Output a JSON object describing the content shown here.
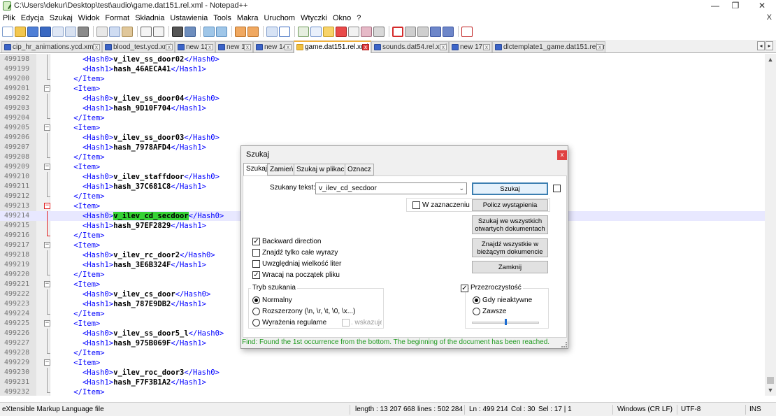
{
  "window": {
    "title": "C:\\Users\\dekur\\Desktop\\test\\audio\\game.dat151.rel.xml - Notepad++",
    "minimize": "—",
    "maximize": "❐",
    "close": "✕"
  },
  "menu": {
    "items": [
      "Plik",
      "Edycja",
      "Szukaj",
      "Widok",
      "Format",
      "Składnia",
      "Ustawienia",
      "Tools",
      "Makra",
      "Uruchom",
      "Wtyczki",
      "Okno",
      "?"
    ],
    "close": "X"
  },
  "tabs": [
    {
      "label": "cip_hr_animations.ycd.xml",
      "close": "x"
    },
    {
      "label": "blood_test.ycd.xml",
      "close": "x"
    },
    {
      "label": "new 12",
      "close": "x"
    },
    {
      "label": "new 13",
      "close": "x"
    },
    {
      "label": "new 14",
      "close": "x"
    },
    {
      "label": "game.dat151.rel.xml",
      "close": "x"
    },
    {
      "label": "sounds.dat54.rel.xml",
      "close": "x"
    },
    {
      "label": "new 17",
      "close": "x"
    },
    {
      "label": "dlctemplate1_game.dat151.rel.xml",
      "close": "x"
    }
  ],
  "tab_scroll": {
    "left": "◂",
    "right": "▸"
  },
  "editor": {
    "lines": [
      {
        "num": "499198",
        "pre": "      ",
        "open": "<Hash0>",
        "text": "v_ilev_ss_door02",
        "close": "</Hash0>"
      },
      {
        "num": "499199",
        "pre": "      ",
        "open": "<Hash1>",
        "text": "hash_46AECA41",
        "close": "</Hash1>"
      },
      {
        "num": "499200",
        "pre": "    ",
        "open": "</Item>",
        "text": "",
        "close": ""
      },
      {
        "num": "499201",
        "pre": "    ",
        "open": "<Item>",
        "text": "",
        "close": ""
      },
      {
        "num": "499202",
        "pre": "      ",
        "open": "<Hash0>",
        "text": "v_ilev_ss_door04",
        "close": "</Hash0>"
      },
      {
        "num": "499203",
        "pre": "      ",
        "open": "<Hash1>",
        "text": "hash_9D10F704",
        "close": "</Hash1>"
      },
      {
        "num": "499204",
        "pre": "    ",
        "open": "</Item>",
        "text": "",
        "close": ""
      },
      {
        "num": "499205",
        "pre": "    ",
        "open": "<Item>",
        "text": "",
        "close": ""
      },
      {
        "num": "499206",
        "pre": "      ",
        "open": "<Hash0>",
        "text": "v_ilev_ss_door03",
        "close": "</Hash0>"
      },
      {
        "num": "499207",
        "pre": "      ",
        "open": "<Hash1>",
        "text": "hash_7978AFD4",
        "close": "</Hash1>"
      },
      {
        "num": "499208",
        "pre": "    ",
        "open": "</Item>",
        "text": "",
        "close": ""
      },
      {
        "num": "499209",
        "pre": "    ",
        "open": "<Item>",
        "text": "",
        "close": ""
      },
      {
        "num": "499210",
        "pre": "      ",
        "open": "<Hash0>",
        "text": "v_ilev_staffdoor",
        "close": "</Hash0>"
      },
      {
        "num": "499211",
        "pre": "      ",
        "open": "<Hash1>",
        "text": "hash_37C681C8",
        "close": "</Hash1>"
      },
      {
        "num": "499212",
        "pre": "    ",
        "open": "</Item>",
        "text": "",
        "close": ""
      },
      {
        "num": "499213",
        "pre": "    ",
        "open": "<Item>",
        "text": "",
        "close": ""
      },
      {
        "num": "499214",
        "pre": "      ",
        "open": "<Hash0>",
        "text": "v_ilev_cd_secdoor",
        "close": "</Hash0>"
      },
      {
        "num": "499215",
        "pre": "      ",
        "open": "<Hash1>",
        "text": "hash_97EF2829",
        "close": "</Hash1>"
      },
      {
        "num": "499216",
        "pre": "    ",
        "open": "</Item>",
        "text": "",
        "close": ""
      },
      {
        "num": "499217",
        "pre": "    ",
        "open": "<Item>",
        "text": "",
        "close": ""
      },
      {
        "num": "499218",
        "pre": "      ",
        "open": "<Hash0>",
        "text": "v_ilev_rc_door2",
        "close": "</Hash0>"
      },
      {
        "num": "499219",
        "pre": "      ",
        "open": "<Hash1>",
        "text": "hash_3E6B324F",
        "close": "</Hash1>"
      },
      {
        "num": "499220",
        "pre": "    ",
        "open": "</Item>",
        "text": "",
        "close": ""
      },
      {
        "num": "499221",
        "pre": "    ",
        "open": "<Item>",
        "text": "",
        "close": ""
      },
      {
        "num": "499222",
        "pre": "      ",
        "open": "<Hash0>",
        "text": "v_ilev_cs_door",
        "close": "</Hash0>"
      },
      {
        "num": "499223",
        "pre": "      ",
        "open": "<Hash1>",
        "text": "hash_787E9DB2",
        "close": "</Hash1>"
      },
      {
        "num": "499224",
        "pre": "    ",
        "open": "</Item>",
        "text": "",
        "close": ""
      },
      {
        "num": "499225",
        "pre": "    ",
        "open": "<Item>",
        "text": "",
        "close": ""
      },
      {
        "num": "499226",
        "pre": "      ",
        "open": "<Hash0>",
        "text": "v_ilev_ss_door5_l",
        "close": "</Hash0>"
      },
      {
        "num": "499227",
        "pre": "      ",
        "open": "<Hash1>",
        "text": "hash_975B069F",
        "close": "</Hash1>"
      },
      {
        "num": "499228",
        "pre": "    ",
        "open": "</Item>",
        "text": "",
        "close": ""
      },
      {
        "num": "499229",
        "pre": "    ",
        "open": "<Item>",
        "text": "",
        "close": ""
      },
      {
        "num": "499230",
        "pre": "      ",
        "open": "<Hash0>",
        "text": "v_ilev_roc_door3",
        "close": "</Hash0>"
      },
      {
        "num": "499231",
        "pre": "      ",
        "open": "<Hash1>",
        "text": "hash_F7F3B1A2",
        "close": "</Hash1>"
      },
      {
        "num": "499232",
        "pre": "    ",
        "open": "</Item>",
        "text": "",
        "close": ""
      },
      {
        "num": "499233",
        "pre": "    ",
        "open": "<Item>",
        "text": "",
        "close": ""
      }
    ],
    "highlight_line": "499214",
    "highlight_text": "v_ilev_cd_secdoor"
  },
  "scrollbar": {
    "up": "▲",
    "down": "▼"
  },
  "find_dialog": {
    "title": "Szukaj",
    "close": "x",
    "tabs": [
      "Szukaj",
      "Zamień",
      "Szukaj w plikach",
      "Oznacz"
    ],
    "search_label": "Szukany tekst:",
    "search_value": "v_ilev_cd_secdoor",
    "chevron": "⌄",
    "in_selection_label": "W zaznaczeniu",
    "buttons": {
      "find": "Szukaj",
      "count": "Policz wystąpienia",
      "find_all_open_line1": "Szukaj we wszystkich",
      "find_all_open_line2": "otwartych dokumentach",
      "find_all_current_line1": "Znajdź wszystkie w",
      "find_all_current_line2": "bieżącym dokumencie",
      "close": "Zamknij"
    },
    "options": [
      {
        "label": "Backward direction",
        "checked": true
      },
      {
        "label": "Znajdź tylko całe wyrazy",
        "checked": false
      },
      {
        "label": "Uwzględniaj wielkość liter",
        "checked": false
      },
      {
        "label": "Wracaj na początek pliku",
        "checked": true
      }
    ],
    "search_mode": {
      "title": "Tryb szukania",
      "normal": "Normalny",
      "extended": "Rozszerzony (\\n, \\r, \\t, \\0, \\x...)",
      "regex": "Wyrażenia regularne",
      "dot_newline": ". wskazuje nową li"
    },
    "transparency": {
      "title": "Przezroczystość",
      "checked": true,
      "on_lose_focus": "Gdy nieaktywne",
      "always": "Zawsze",
      "level": 0.5
    },
    "status": "Find: Found the 1st occurrence from the bottom. The beginning of the document has been reached."
  },
  "status_bar": {
    "file_type": "eXtensible Markup Language file",
    "length": "length : 13 207 668",
    "lines": "lines : 502 284",
    "position": "Ln : 499 214",
    "col": "Col : 30",
    "sel": "Sel : 17 | 1",
    "eol": "Windows (CR LF)",
    "encoding": "UTF-8",
    "mode": "INS"
  },
  "colors": {
    "tag": "#0000ff",
    "match_highlight": "#34d134",
    "active_tab_accent": "#f2b13b",
    "dialog_status": "#1f9a1f",
    "close_red": "#e04343"
  }
}
